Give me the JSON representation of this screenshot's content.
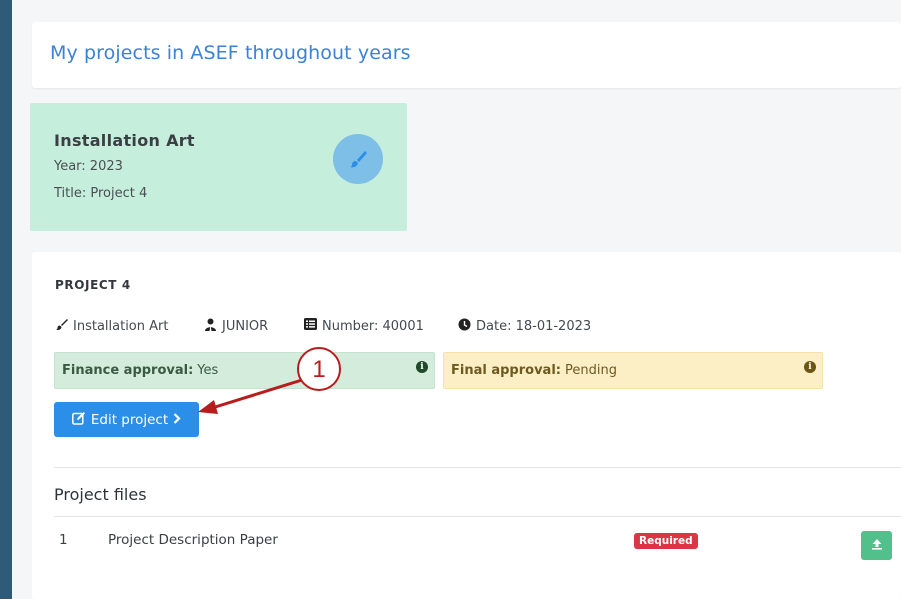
{
  "header": {
    "title": "My projects in ASEF throughout years"
  },
  "project_card": {
    "category": "Installation Art",
    "year": "Year: 2023",
    "title": "Title: Project 4",
    "icon": "paint-brush-icon"
  },
  "project": {
    "heading": "PROJECT 4",
    "meta": {
      "category": "Installation Art",
      "level": "JUNIOR",
      "number": "Number: 40001",
      "date": "Date: 18-01-2023"
    },
    "finance_approval": {
      "label": "Finance approval:",
      "value": "Yes"
    },
    "final_approval": {
      "label": "Final approval:",
      "value": "Pending"
    },
    "edit_button": "Edit project"
  },
  "files": {
    "title": "Project files",
    "rows": [
      {
        "num": "1",
        "name": "Project Description Paper",
        "badge": "Required"
      }
    ]
  },
  "annotation": {
    "label": "1"
  },
  "colors": {
    "accent": "#2b8ee8",
    "title": "#3b82d6",
    "card_bg": "#c6eedc",
    "required": "#dc3545",
    "upload": "#52c08a",
    "arrow": "#b81c1c"
  }
}
